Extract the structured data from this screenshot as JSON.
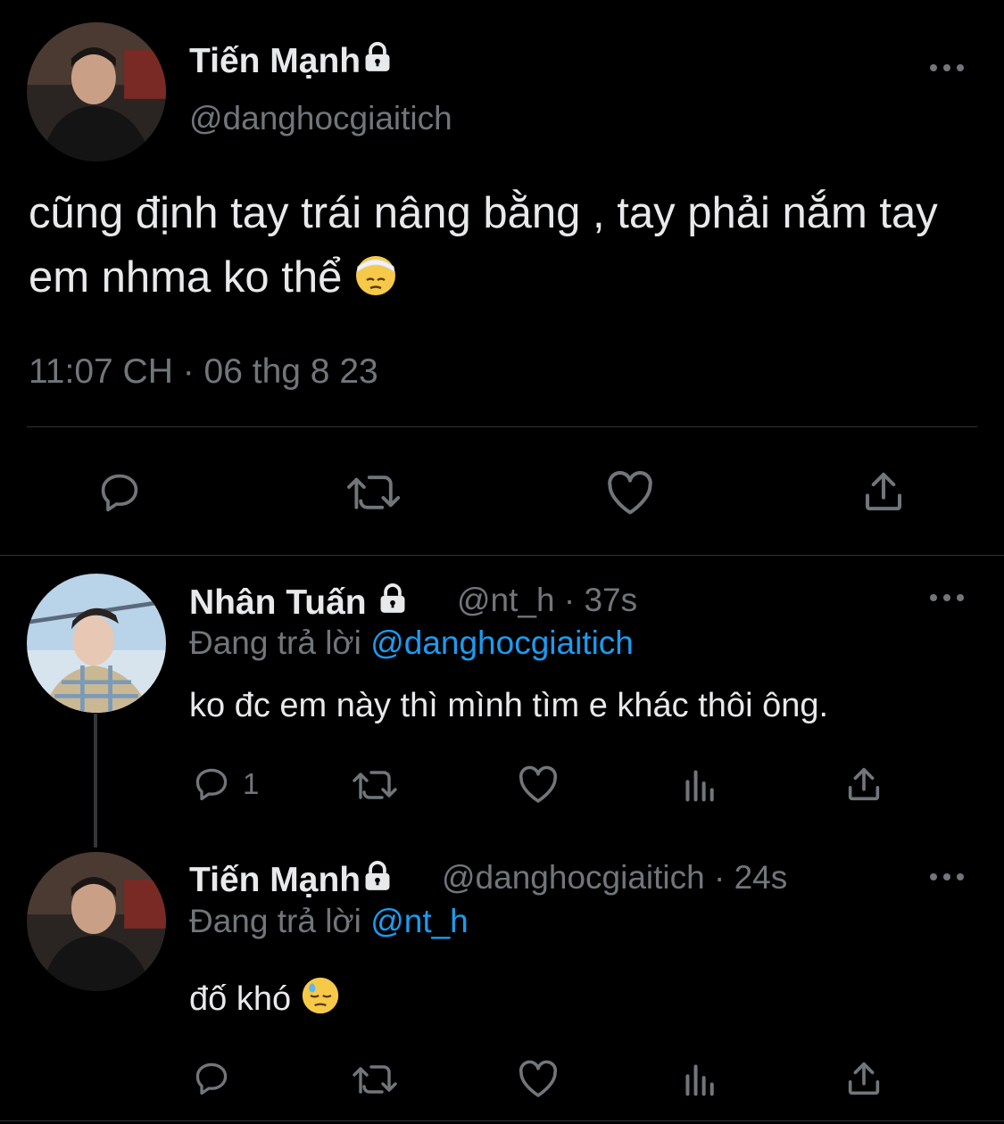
{
  "main_tweet": {
    "author_name": "Tiến Mạnh",
    "author_handle": "@danghocgiaitich",
    "text": "cũng định tay trái nâng bằng , tay phải nắm tay em nhma ko thể",
    "emoji": "face-with-head-bandage",
    "timestamp": "11:07 CH · 06 thg 8 23",
    "actions": [
      "reply-icon",
      "retweet-icon",
      "like-icon",
      "share-icon"
    ]
  },
  "reply1": {
    "author_name": "Nhân Tuấn",
    "author_handle": "@nt_h",
    "time": "· 37s",
    "replying_prefix": "Đang trả lời",
    "replying_to": "@danghocgiaitich",
    "text": "ko đc em này thì mình tìm e khác thôi ông.",
    "reply_count": "1"
  },
  "reply2": {
    "author_name": "Tiến Mạnh",
    "author_handle": "@danghocgiaitich",
    "time": "· 24s",
    "replying_prefix": "Đang trả lời",
    "replying_to": "@nt_h",
    "text": "đố khó",
    "emoji": "downcast-face-with-sweat"
  },
  "colors": {
    "background": "#000000",
    "text": "#e7e9ea",
    "muted": "#71767b",
    "link": "#1d9bf0",
    "divider": "#2f3336"
  }
}
